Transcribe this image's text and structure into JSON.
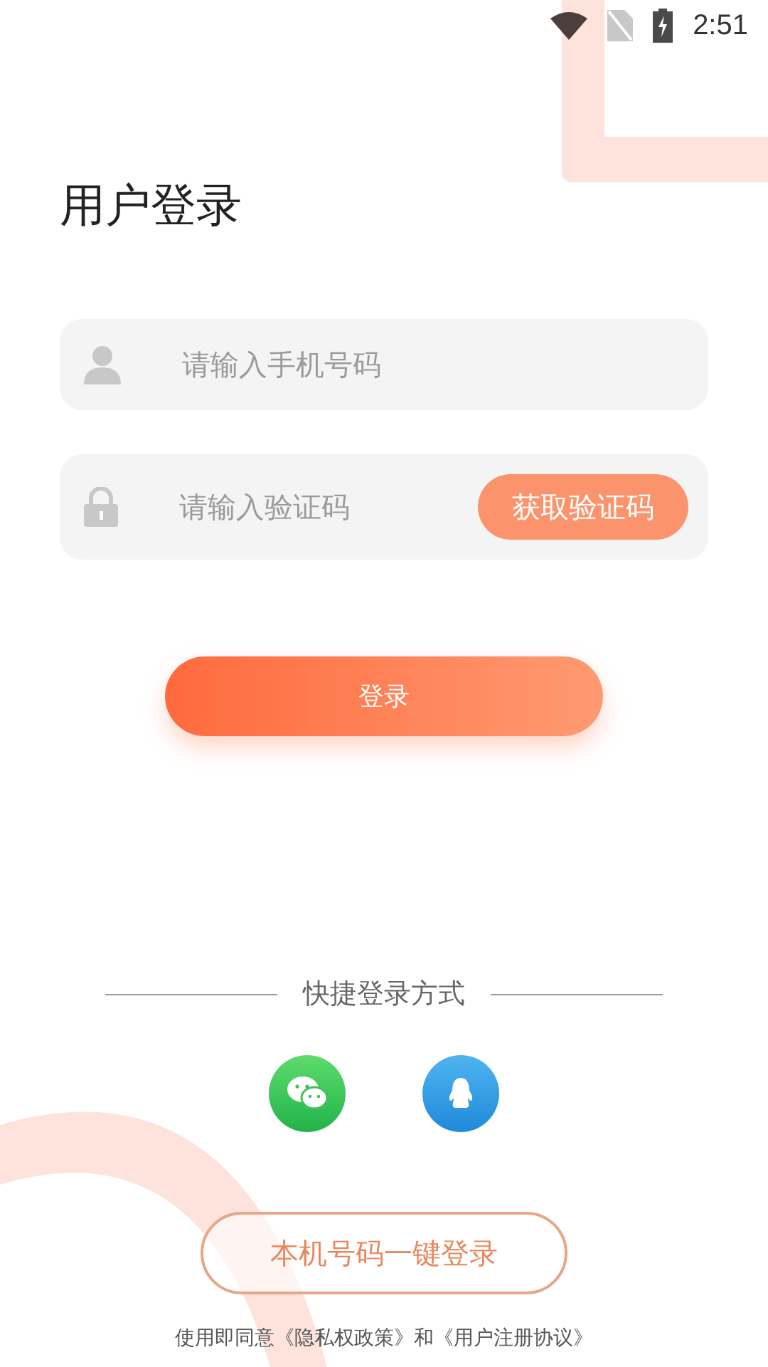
{
  "status_bar": {
    "time": "2:51"
  },
  "title": "用户登录",
  "phone_field": {
    "placeholder": "请输入手机号码"
  },
  "code_field": {
    "placeholder": "请输入验证码",
    "button": "获取验证码"
  },
  "login_button": "登录",
  "quick_login": {
    "label": "快捷登录方式",
    "options": [
      {
        "kind": "wechat"
      },
      {
        "kind": "qq"
      }
    ]
  },
  "one_tap_button": "本机号码一键登录",
  "footer": {
    "prefix": "使用即同意",
    "first_link": "《隐私权政策》",
    "joiner": "和",
    "second_link": "《用户注册协议》"
  }
}
